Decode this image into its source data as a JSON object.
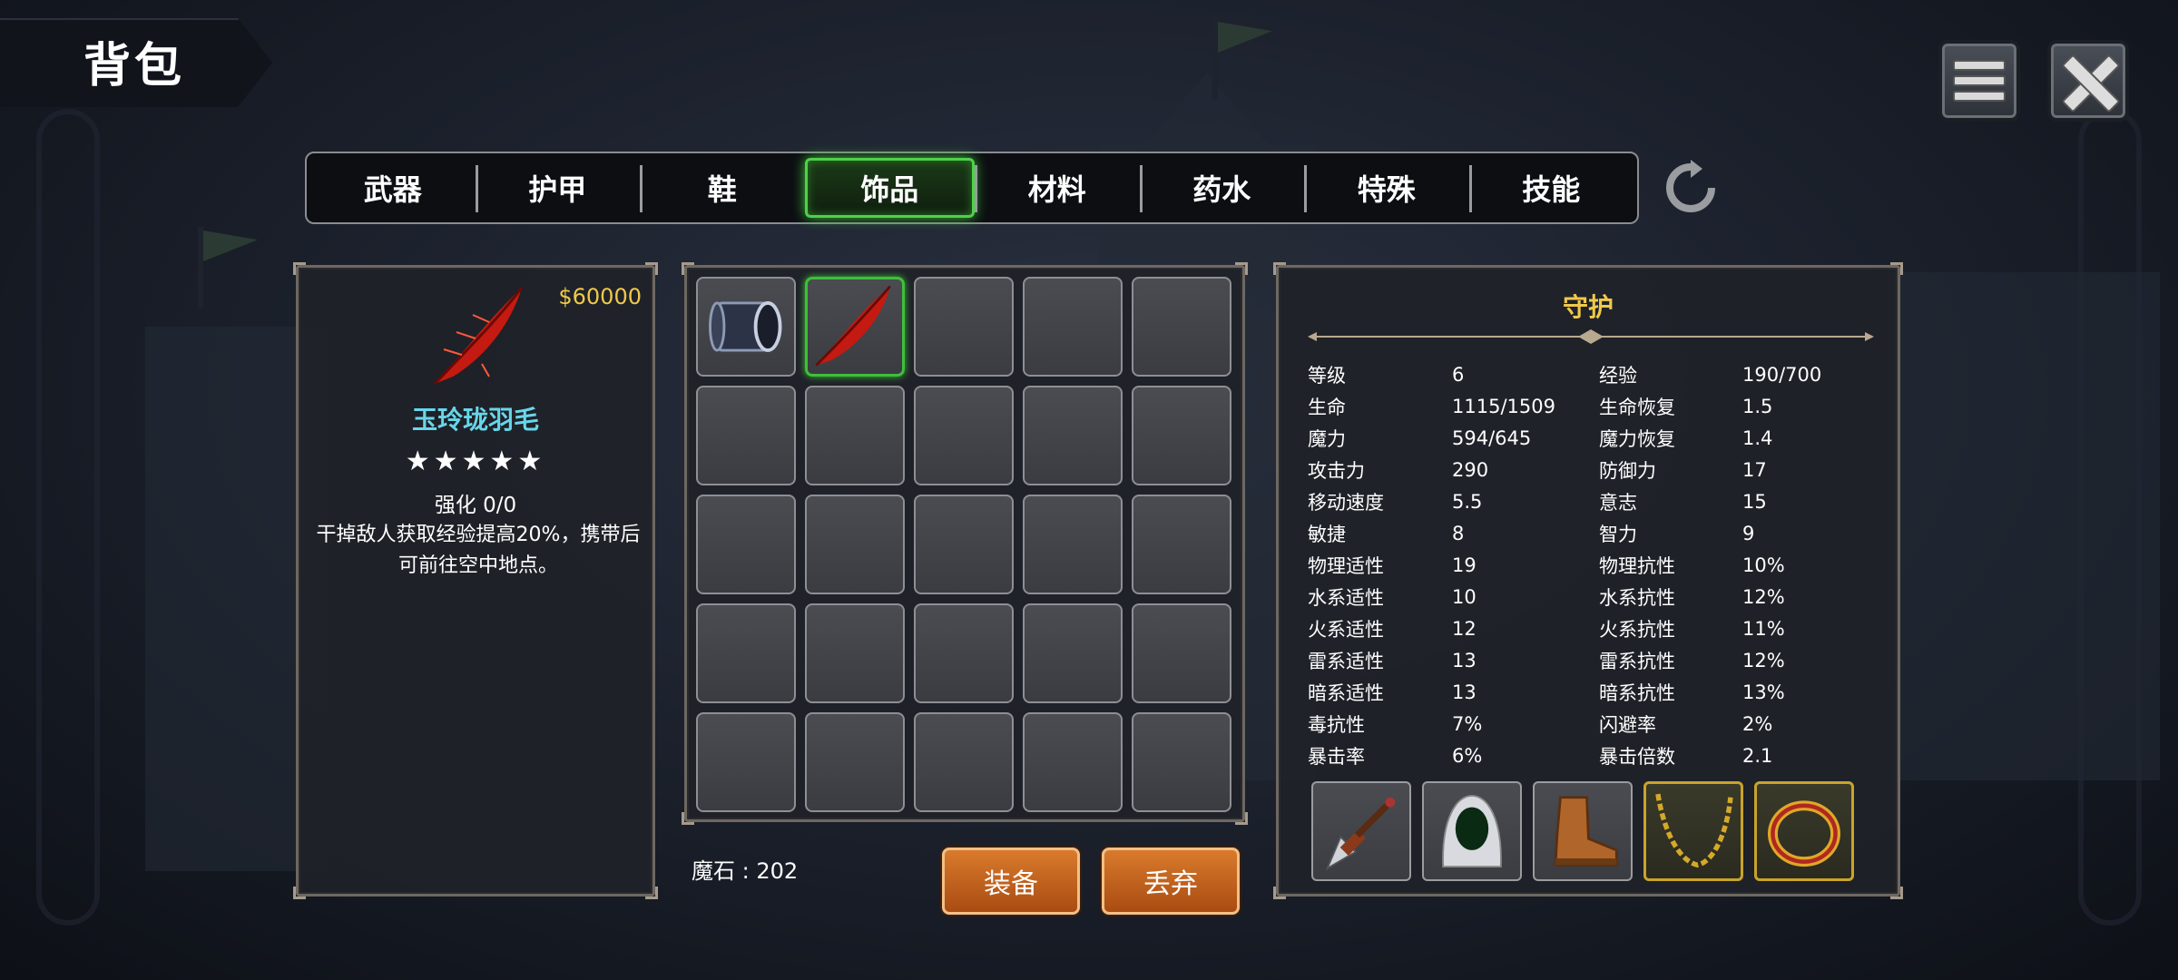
{
  "header": {
    "title": "背包"
  },
  "tabs": [
    {
      "label": "武器",
      "active": false
    },
    {
      "label": "护甲",
      "active": false
    },
    {
      "label": "鞋",
      "active": false
    },
    {
      "label": "饰品",
      "active": true
    },
    {
      "label": "材料",
      "active": false
    },
    {
      "label": "药水",
      "active": false
    },
    {
      "label": "特殊",
      "active": false
    },
    {
      "label": "技能",
      "active": false
    }
  ],
  "item_detail": {
    "price": "$60000",
    "name": "玉玲珑羽毛",
    "stars": "★★★★★",
    "enhance": "强化 0/0",
    "description": "干掉敌人获取经验提高20%，携带后可前往空中地点。",
    "icon": "red-feather-icon"
  },
  "inventory": {
    "slots": [
      {
        "item": "scroll-icon",
        "selected": false
      },
      {
        "item": "red-feather-icon",
        "selected": true
      }
    ],
    "magic_stone": "魔石 : 202"
  },
  "actions": {
    "equip": "装备",
    "drop": "丢弃"
  },
  "stats": {
    "title": "守护",
    "rows": [
      [
        "等级",
        "6",
        "经验",
        "190/700"
      ],
      [
        "生命",
        "1115/1509",
        "生命恢复",
        "1.5"
      ],
      [
        "魔力",
        "594/645",
        "魔力恢复",
        "1.4"
      ],
      [
        "攻击力",
        "290",
        "防御力",
        "17"
      ],
      [
        "移动速度",
        "5.5",
        "意志",
        "15"
      ],
      [
        "敏捷",
        "8",
        "智力",
        "9"
      ],
      [
        "物理适性",
        "19",
        "物理抗性",
        "10%"
      ],
      [
        "水系适性",
        "10",
        "水系抗性",
        "12%"
      ],
      [
        "火系适性",
        "12",
        "火系抗性",
        "11%"
      ],
      [
        "雷系适性",
        "13",
        "雷系抗性",
        "12%"
      ],
      [
        "暗系适性",
        "13",
        "暗系抗性",
        "13%"
      ],
      [
        "毒抗性",
        "7%",
        "闪避率",
        "2%"
      ],
      [
        "暴击率",
        "6%",
        "暴击倍数",
        "2.1"
      ]
    ]
  },
  "equipment": [
    {
      "icon": "dagger-icon"
    },
    {
      "icon": "hood-icon"
    },
    {
      "icon": "boot-icon"
    },
    {
      "icon": "chain-necklace-icon"
    },
    {
      "icon": "gold-ring-icon"
    }
  ],
  "colors": {
    "price": "#f0c94a",
    "item_name": "#68d6ea",
    "active_tab": "#4fd14a",
    "action_button": "#c2621f"
  }
}
